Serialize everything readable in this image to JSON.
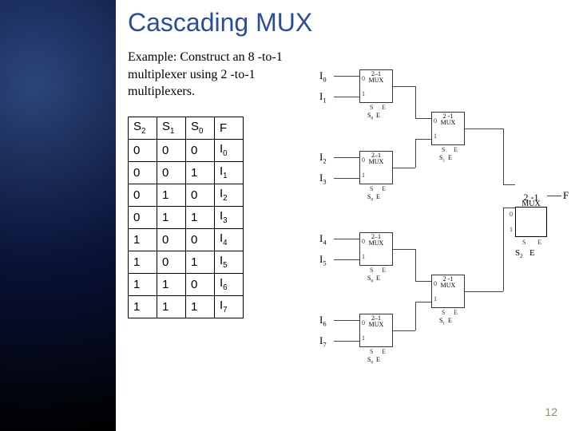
{
  "title": "Cascading MUX",
  "example": "Example: Construct an 8 -to-1 multiplexer using 2 -to-1 multiplexers.",
  "truth": {
    "headers": [
      "S2",
      "S1",
      "S0",
      "F"
    ],
    "rows": [
      [
        "0",
        "0",
        "0",
        "I0"
      ],
      [
        "0",
        "0",
        "1",
        "I1"
      ],
      [
        "0",
        "1",
        "0",
        "I2"
      ],
      [
        "0",
        "1",
        "1",
        "I3"
      ],
      [
        "1",
        "0",
        "0",
        "I4"
      ],
      [
        "1",
        "0",
        "1",
        "I5"
      ],
      [
        "1",
        "1",
        "0",
        "I6"
      ],
      [
        "1",
        "1",
        "1",
        "I7"
      ]
    ]
  },
  "inputs": [
    "I0",
    "I1",
    "I2",
    "I3",
    "I4",
    "I5",
    "I6",
    "I7"
  ],
  "mux_label_small": "2–1\nMUX",
  "mux_label_med": "2 -1\nMUX",
  "stage1_sel": {
    "s": "S0",
    "e": "E"
  },
  "stage2_sel": {
    "s": "S1",
    "e": "E"
  },
  "stage3_sel": {
    "s": "S",
    "e": "E"
  },
  "final_sel": {
    "s": "S2",
    "e": "E"
  },
  "final_out": "F",
  "page_num": "12",
  "chart_data": {
    "type": "table",
    "title": "Truth table: 8-to-1 multiplexer output F as a function of select lines S2 S1 S0",
    "headers": [
      "S2",
      "S1",
      "S0",
      "F"
    ],
    "rows": [
      {
        "S2": 0,
        "S1": 0,
        "S0": 0,
        "F": "I0"
      },
      {
        "S2": 0,
        "S1": 0,
        "S0": 1,
        "F": "I1"
      },
      {
        "S2": 0,
        "S1": 1,
        "S0": 0,
        "F": "I2"
      },
      {
        "S2": 0,
        "S1": 1,
        "S0": 1,
        "F": "I3"
      },
      {
        "S2": 1,
        "S1": 0,
        "S0": 0,
        "F": "I4"
      },
      {
        "S2": 1,
        "S1": 0,
        "S0": 1,
        "F": "I5"
      },
      {
        "S2": 1,
        "S1": 1,
        "S0": 0,
        "F": "I6"
      },
      {
        "S2": 1,
        "S1": 1,
        "S0": 1,
        "F": "I7"
      }
    ]
  }
}
